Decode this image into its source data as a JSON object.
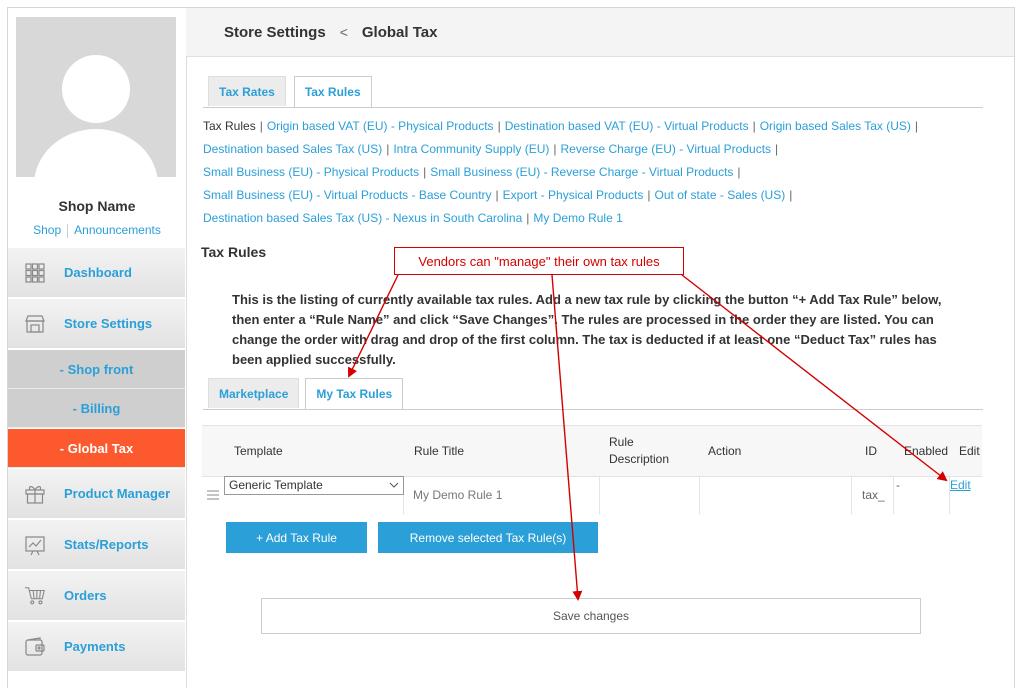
{
  "sidebar": {
    "shop_name": "Shop Name",
    "links": [
      "Shop",
      "Announcements"
    ],
    "nav": [
      {
        "label": "Dashboard",
        "icon": "grid-icon"
      },
      {
        "label": "Store Settings",
        "icon": "store-icon"
      },
      {
        "label": "Product Manager",
        "icon": "gift-icon"
      },
      {
        "label": "Stats/Reports",
        "icon": "chart-icon"
      },
      {
        "label": "Orders",
        "icon": "cart-icon"
      },
      {
        "label": "Payments",
        "icon": "wallet-icon"
      }
    ],
    "sub": [
      {
        "label": "- Shop front"
      },
      {
        "label": "- Billing"
      },
      {
        "label": "- Global Tax"
      }
    ]
  },
  "header": {
    "crumb1": "Store Settings",
    "sep": "<",
    "crumb2": "Global Tax"
  },
  "top_tabs": [
    "Tax Rates",
    "Tax Rules"
  ],
  "rules": {
    "current": "Tax Rules",
    "items": [
      "Origin based VAT (EU) - Physical Products",
      "Destination based VAT (EU) - Virtual Products",
      "Origin based Sales Tax (US)",
      "Destination based Sales Tax (US)",
      "Intra Community Supply (EU)",
      "Reverse Charge (EU) - Virtual Products",
      "Small Business (EU) - Physical Products",
      "Small Business (EU) - Reverse Charge - Virtual Products",
      "Small Business (EU) - Virtual Products - Base Country",
      "Export - Physical Products",
      "Out of state - Sales (US)",
      "Destination based Sales Tax (US) - Nexus in South Carolina",
      "My Demo Rule 1"
    ]
  },
  "section_title": "Tax Rules",
  "description": "This is the listing of currently available tax rules. Add a new tax rule by clicking the button “+ Add Tax Rule” below, then enter a “Rule Name” and click “Save Changes”. The rules are processed in the order they are listed. You can change the order with drag and drop of the first column. The tax is deducted if at least one “Deduct Tax” rules has been applied successfully.",
  "inner_tabs": [
    "Marketplace",
    "My Tax Rules"
  ],
  "table": {
    "headers": {
      "template": "Template",
      "title": "Rule Title",
      "description": "Rule Description",
      "action": "Action",
      "id": "ID",
      "enabled": "Enabled",
      "edit": "Edit"
    },
    "row": {
      "template": "Generic Template",
      "title": "My Demo Rule 1",
      "id": "tax_",
      "enabled": "-",
      "edit": "Edit"
    }
  },
  "buttons": {
    "add": "+ Add Tax Rule",
    "remove": "Remove selected Tax Rule(s)",
    "save": "Save changes"
  },
  "callout": "Vendors can \"manage\" their own tax rules",
  "colors": {
    "accent": "#2b9fd8",
    "active": "#fc5a2e",
    "annotation": "#d40000"
  }
}
